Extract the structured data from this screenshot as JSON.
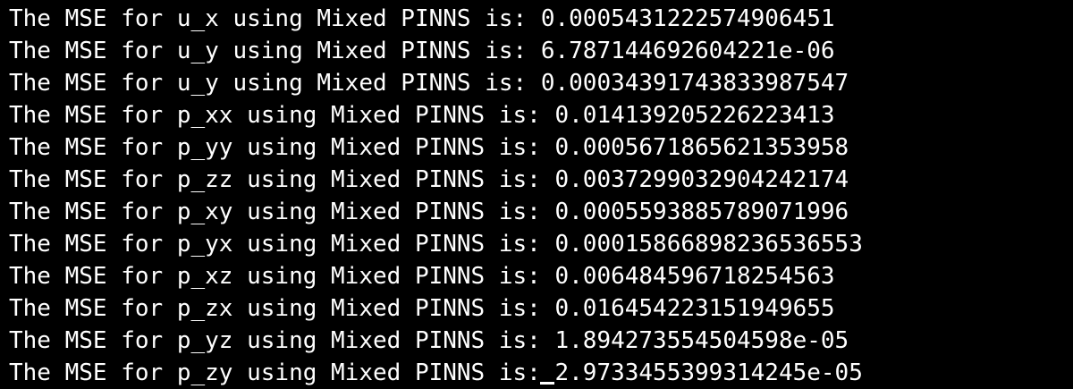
{
  "terminal": {
    "lines": [
      {
        "prefix": "The MSE for u_x using Mixed PINNS is: ",
        "value": "0.0005431222574906451"
      },
      {
        "prefix": "The MSE for u_y using Mixed PINNS is: ",
        "value": "6.787144692604221e-06"
      },
      {
        "prefix": "The MSE for u_y using Mixed PINNS is: ",
        "value": "0.00034391743833987547"
      },
      {
        "prefix": "The MSE for p_xx using Mixed PINNS is: ",
        "value": "0.014139205226223413"
      },
      {
        "prefix": "The MSE for p_yy using Mixed PINNS is: ",
        "value": "0.0005671865621353958"
      },
      {
        "prefix": "The MSE for p_zz using Mixed PINNS is: ",
        "value": "0.0037299032904242174"
      },
      {
        "prefix": "The MSE for p_xy using Mixed PINNS is: ",
        "value": "0.0005593885789071996"
      },
      {
        "prefix": "The MSE for p_yx using Mixed PINNS is: ",
        "value": "0.00015866898236536553"
      },
      {
        "prefix": "The MSE for p_xz using Mixed PINNS is: ",
        "value": "0.006484596718254563"
      },
      {
        "prefix": "The MSE for p_zx using Mixed PINNS is: ",
        "value": "0.016454223151949655"
      },
      {
        "prefix": "The MSE for p_yz using Mixed PINNS is: ",
        "value": "1.894273554504598e-05"
      },
      {
        "prefix": "The MSE for p_zy using Mixed PINNS is: ",
        "value": "2.9733455399314245e-05"
      }
    ],
    "colors": {
      "background": "#000000",
      "foreground": "#ffffff"
    }
  }
}
